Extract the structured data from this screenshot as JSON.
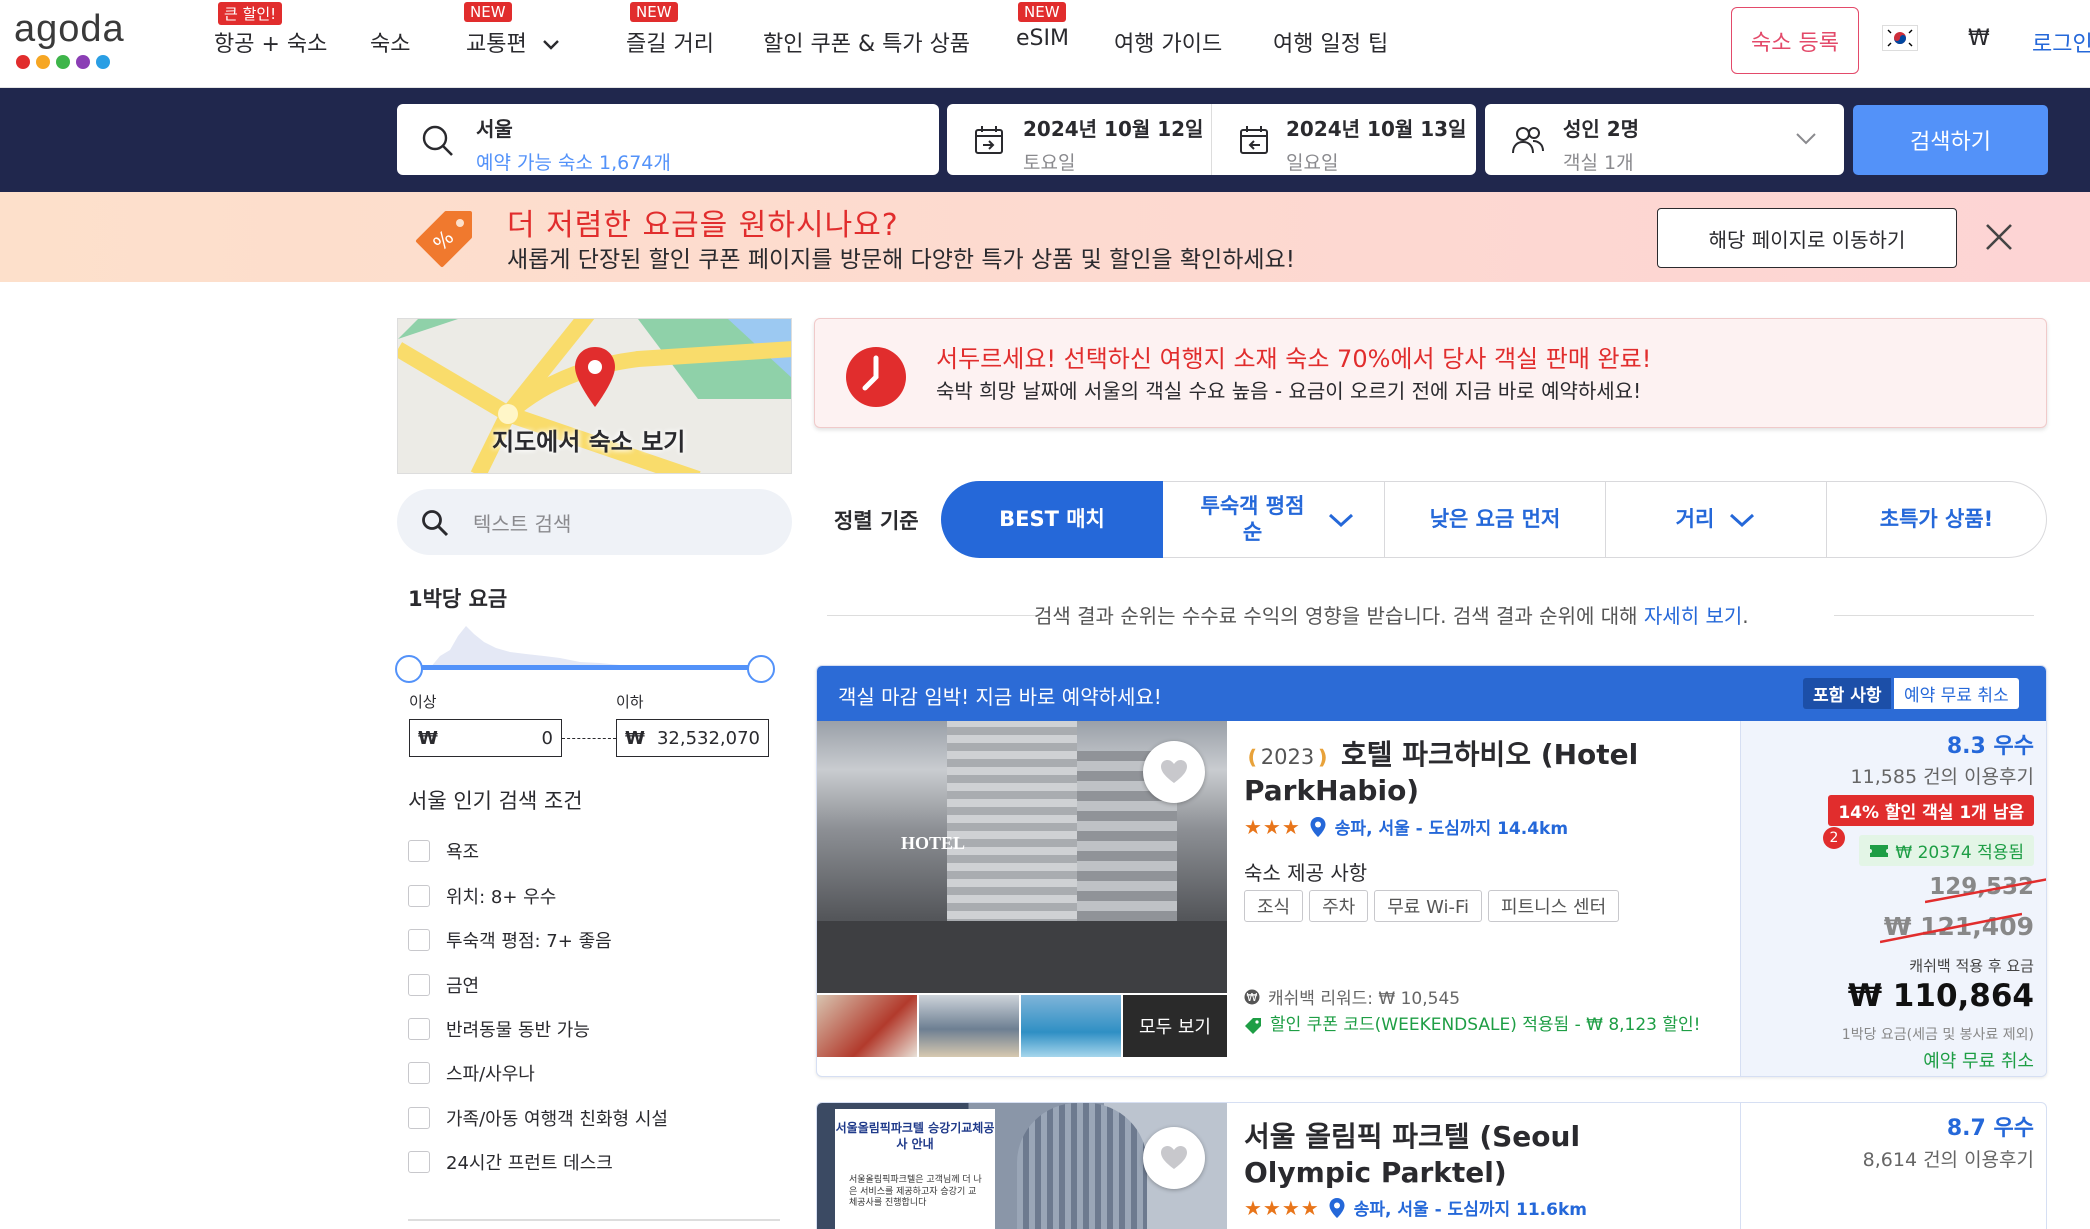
{
  "brand": {
    "logo_text": "agoda",
    "dot_colors": [
      "#e12d2d",
      "#f6a623",
      "#3eb54a",
      "#8b3eb5",
      "#2a9ee4"
    ]
  },
  "nav": {
    "items": [
      {
        "label": "항공 + 숙소",
        "badge": "큰 할인!"
      },
      {
        "label": "숙소",
        "badge": ""
      },
      {
        "label": "교통편",
        "badge": "NEW"
      },
      {
        "label": "즐길 거리",
        "badge": "NEW"
      },
      {
        "label": "할인 쿠폰 & 특가 상품",
        "badge": ""
      },
      {
        "label": "eSIM",
        "badge": "NEW"
      },
      {
        "label": "여행 가이드",
        "badge": ""
      },
      {
        "label": "여행 일정 팁",
        "badge": ""
      }
    ],
    "host_label": "숙소 등록",
    "currency": "₩",
    "login": "로그인"
  },
  "search": {
    "destination": "서울",
    "destination_sub": "예약 가능 숙소 1,674개",
    "checkin": "2024년 10월 12일",
    "checkin_day": "토요일",
    "checkout": "2024년 10월 13일",
    "checkout_day": "일요일",
    "guests": "성인 2명",
    "rooms": "객실 1개",
    "button": "검색하기"
  },
  "promo": {
    "title": "더 저렴한 요금을 원하시나요?",
    "text": "새롭게 단장된 할인 쿠폰 페이지를 방문해 다양한 특가 상품 및 할인을 확인하세요!",
    "button": "해당 페이지로 이동하기"
  },
  "sidebar": {
    "map_label": "지도에서 숙소 보기",
    "text_search_placeholder": "텍스트 검색",
    "price_title": "1박당 요금",
    "min_label": "이상",
    "max_label": "이하",
    "currency": "₩",
    "min_value": "0",
    "max_value": "32,532,070",
    "popular_title": "서울 인기 검색 조건",
    "filters": [
      "욕조",
      "위치: 8+ 우수",
      "투숙객 평점: 7+ 좋음",
      "금연",
      "반려동물 동반 가능",
      "스파/사우나",
      "가족/아동 여행객 친화형 시설",
      "24시간 프런트 데스크"
    ]
  },
  "urgency": {
    "title": "서두르세요! 선택하신 여행지 소재 숙소 70%에서 당사 객실 판매 완료!",
    "text": "숙박 희망 날짜에 서울의 객실 수요 높음 - 요금이 오르기 전에 지금 바로 예약하세요!"
  },
  "sort": {
    "label": "정렬 기준",
    "tabs": [
      "BEST 매치",
      "투숙객 평점 순",
      "낮은 요금 먼저",
      "거리",
      "초특가 상품!"
    ]
  },
  "disclaimer": {
    "text": "검색 결과 순위는 수수료 수익의 영향을 받습니다. 검색 결과 순위에 대해 ",
    "link": "자세히 보기",
    "end": "."
  },
  "hotels": [
    {
      "banner": "객실 마감 임박! 지금 바로 예약하세요!",
      "tag_included": "포함 사항",
      "tag_cancel": "예약 무료 취소",
      "year": "2023",
      "name": "호텔 파크하비오 (Hotel ParkHabio)",
      "stars": "★★★",
      "location": "송파, 서울 - 도심까지 14.4km",
      "amenities_title": "숙소 제공 사항",
      "amenities": [
        "조식",
        "주차",
        "무료 Wi-Fi",
        "피트니스 센터"
      ],
      "cashback": "캐쉬백 리워드: ₩ 10,545",
      "coupon": "할인 쿠폰 코드(WEEKENDSALE) 적용됨 - ₩ 8,123 할인!",
      "see_all": "모두 보기",
      "score": "8.3 우수",
      "reviews": "11,585 건의 이용후기",
      "deal": "14% 할인 객실 1개 남음",
      "coupon_count": "2",
      "coupon_applied": "₩ 20374 적용됨",
      "orig_price": "129,532",
      "strike_price": "₩ 121,409",
      "after_cashback": "캐쉬백 적용 후 요금",
      "price": "₩ 110,864",
      "per_night": "1박당 요금(세금 및 봉사료 제외)",
      "free_cancel": "예약 무료 취소",
      "hotel_sign": "HOTEL"
    },
    {
      "name": "서울 올림픽 파크텔 (Seoul Olympic Parktel)",
      "stars": "★★★★",
      "location": "송파, 서울 - 도심까지 11.6km",
      "score": "8.7 우수",
      "reviews": "8,614 건의 이용후기",
      "sign_title": "서울올림픽파크텔 승강기교체공사 안내",
      "sign_body": "서울올림픽파크텔은 고객님께 더 나은 서비스를 제공하고자 승강기 교체공사를 진행합니다"
    }
  ]
}
